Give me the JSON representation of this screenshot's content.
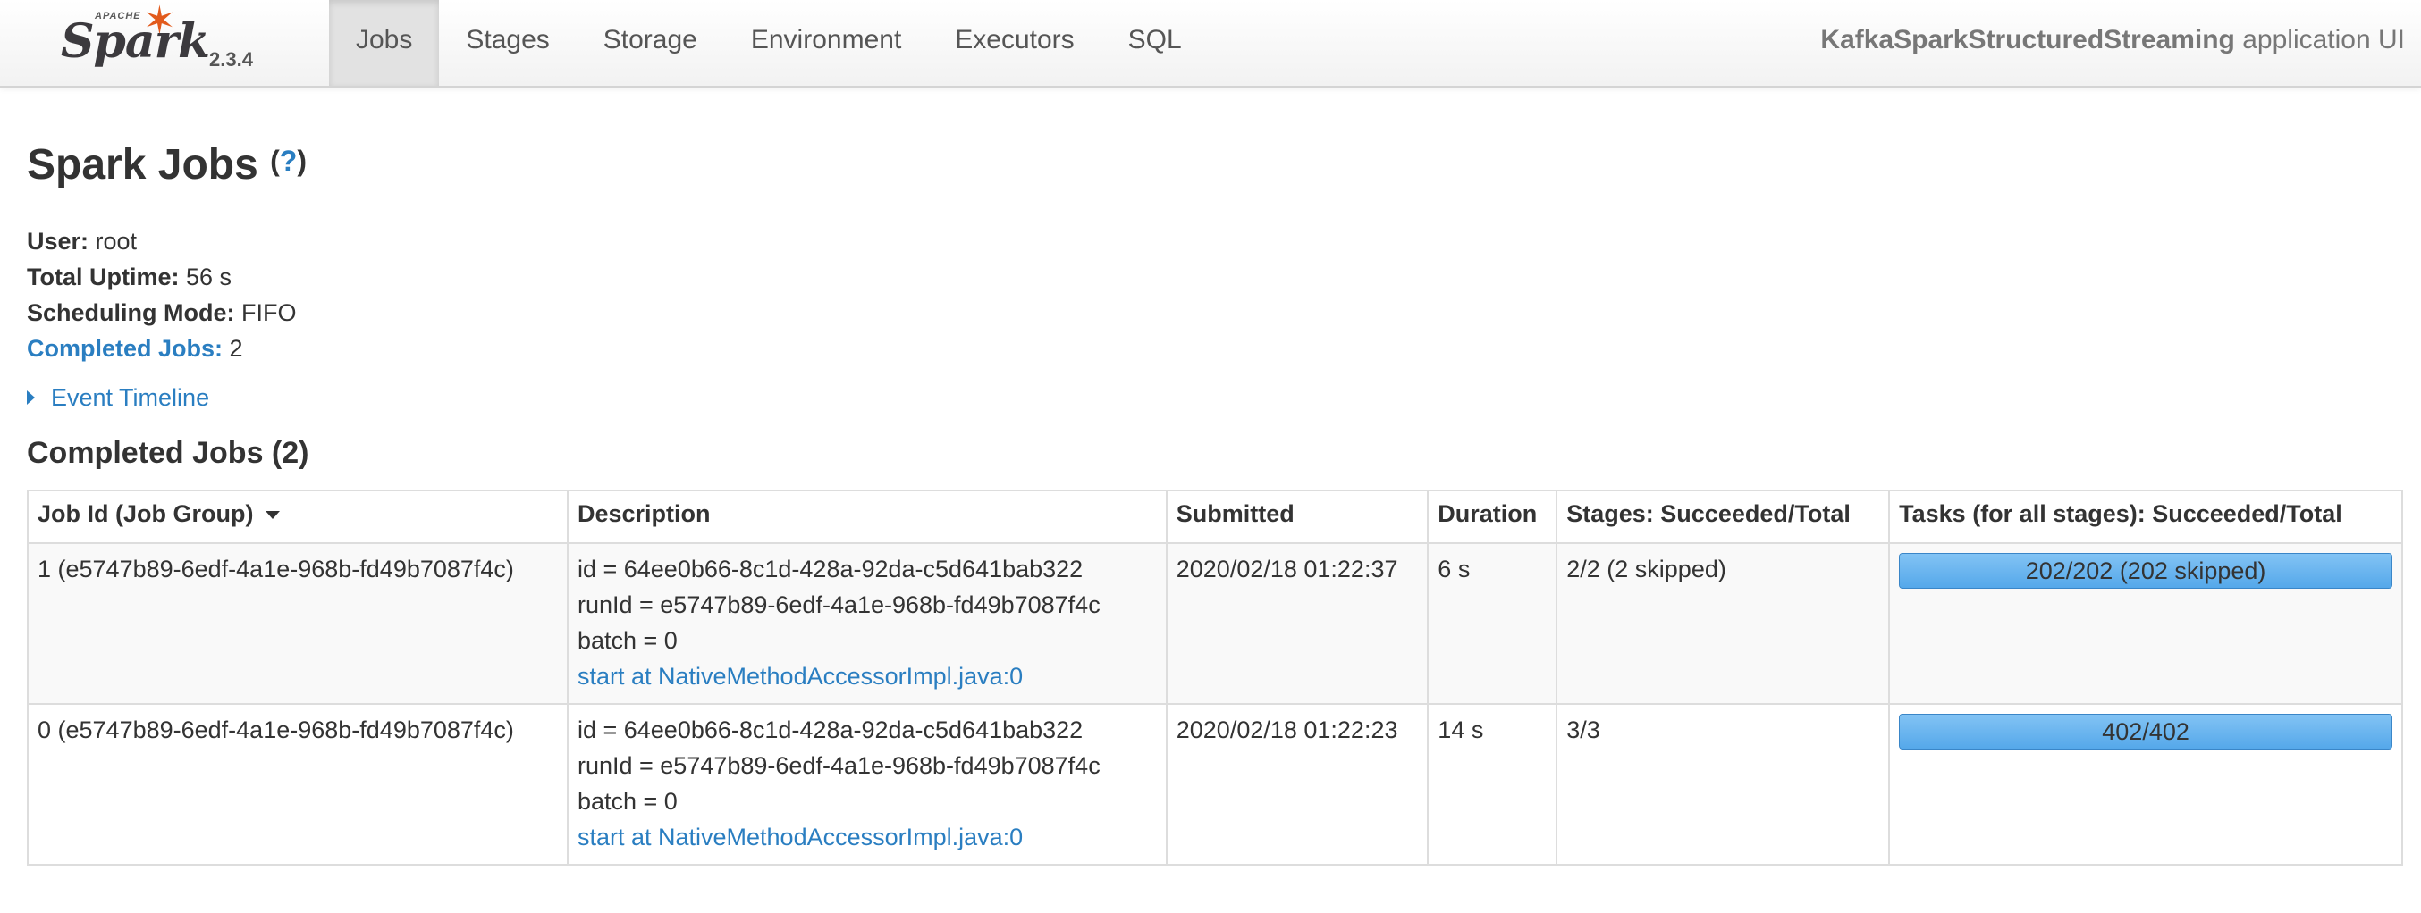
{
  "brand": {
    "apache": "APACHE",
    "name": "Spark",
    "version": "2.3.4",
    "logo_color": "#e25a1c"
  },
  "nav": {
    "tabs": [
      {
        "label": "Jobs",
        "active": true
      },
      {
        "label": "Stages",
        "active": false
      },
      {
        "label": "Storage",
        "active": false
      },
      {
        "label": "Environment",
        "active": false
      },
      {
        "label": "Executors",
        "active": false
      },
      {
        "label": "SQL",
        "active": false
      }
    ],
    "app_name": "KafkaSparkStructuredStreaming",
    "app_suffix": " application UI"
  },
  "page": {
    "title": "Spark Jobs",
    "help_open": "(",
    "help_q": "?",
    "help_close": ")"
  },
  "summary": {
    "user_label": "User:",
    "user_value": " root",
    "uptime_label": "Total Uptime:",
    "uptime_value": " 56 s",
    "scheduling_label": "Scheduling Mode:",
    "scheduling_value": " FIFO",
    "completed_label": "Completed Jobs:",
    "completed_value": " 2"
  },
  "timeline": {
    "label": "Event Timeline"
  },
  "completed_jobs": {
    "title": "Completed Jobs (2)",
    "columns": [
      "Job Id (Job Group)",
      "Description",
      "Submitted",
      "Duration",
      "Stages: Succeeded/Total",
      "Tasks (for all stages): Succeeded/Total"
    ],
    "rows": [
      {
        "job_id": "1 (e5747b89-6edf-4a1e-968b-fd49b7087f4c)",
        "desc_lines": [
          "id = 64ee0b66-8c1d-428a-92da-c5d641bab322",
          "runId = e5747b89-6edf-4a1e-968b-fd49b7087f4c",
          "batch = 0"
        ],
        "desc_link": "start at NativeMethodAccessorImpl.java:0",
        "submitted": "2020/02/18 01:22:37",
        "duration": "6 s",
        "stages": "2/2 (2 skipped)",
        "tasks": "202/202 (202 skipped)",
        "tasks_progress": 1.0
      },
      {
        "job_id": "0 (e5747b89-6edf-4a1e-968b-fd49b7087f4c)",
        "desc_lines": [
          "id = 64ee0b66-8c1d-428a-92da-c5d641bab322",
          "runId = e5747b89-6edf-4a1e-968b-fd49b7087f4c",
          "batch = 0"
        ],
        "desc_link": "start at NativeMethodAccessorImpl.java:0",
        "submitted": "2020/02/18 01:22:23",
        "duration": "14 s",
        "stages": "3/3",
        "tasks": "402/402",
        "tasks_progress": 1.0
      }
    ]
  },
  "colors": {
    "link": "#2a7ec1",
    "progress": "#55a8ea",
    "active_tab": "#e2e2e2"
  }
}
